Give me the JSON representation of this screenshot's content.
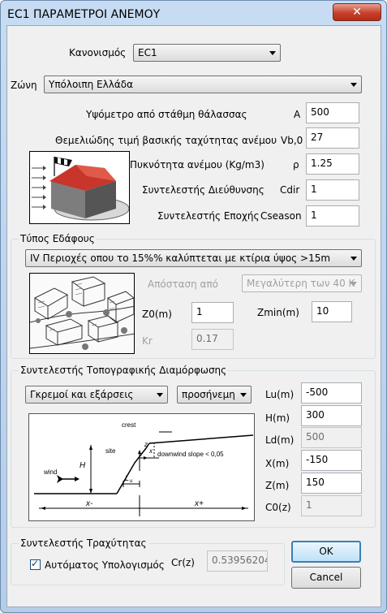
{
  "window": {
    "title": "EC1 ΠΑΡΑΜΕΤΡΟΙ ΑΝΕΜΟΥ",
    "close_glyph": "✕"
  },
  "regulation": {
    "label": "Κανονισμός",
    "value": "EC1"
  },
  "zone": {
    "label": "Ζώνη",
    "value": "Υπόλοιπη Ελλάδα"
  },
  "params": [
    {
      "label": "Υψόμετρο από στάθμη θάλασσας",
      "symbol": "A",
      "value": "500"
    },
    {
      "label": "Θεμελιώδης τιμή βασικής ταχύτητας ανέμου",
      "symbol": "Vb,0",
      "value": "27"
    },
    {
      "label": "Πυκνότητα ανέμου (Kg/m3)",
      "symbol": "ρ",
      "value": "1.25"
    },
    {
      "label": "Συντελεστής Διεύθυνσης",
      "symbol": "Cdir",
      "value": "1"
    },
    {
      "label": "Συντελεστής Εποχής",
      "symbol": "Cseason",
      "value": "1"
    }
  ],
  "terrain": {
    "title": "Τύπος Εδάφους",
    "category": "IV Περιοχές οπου το 15%% καλύπτεται με κτίρια ύψος >15m",
    "distance_label": "Απόσταση από",
    "distance_value": "Μεγαλύτερη των 40 K",
    "z0_label": "Z0(m)",
    "z0_value": "1",
    "zmin_label": "Zmin(m)",
    "zmin_value": "10",
    "kr_label": "Kr",
    "kr_value": "0.17"
  },
  "topography": {
    "title": "Συντελεστής Τοπογραφικής Διαμόρφωσης",
    "type_value": "Γκρεμοί και εξάρσεις",
    "orientation_value": "προσήνεμη",
    "fields": [
      {
        "label": "Lu(m)",
        "value": "-500",
        "readonly": false
      },
      {
        "label": "H(m)",
        "value": "300",
        "readonly": false
      },
      {
        "label": "Ld(m)",
        "value": "500",
        "readonly": true
      },
      {
        "label": "X(m)",
        "value": "-150",
        "readonly": false
      },
      {
        "label": "Z(m)",
        "value": "150",
        "readonly": false
      },
      {
        "label": "C0(z)",
        "value": "1",
        "readonly": true
      }
    ],
    "diagram": {
      "crest": "crest",
      "wind": "wind",
      "site": "site",
      "downwind": "downwind slope < 0,05",
      "h": "H",
      "z": "z",
      "x": "x",
      "lu": "L",
      "lu_sub": "u",
      "x_minus": "x-",
      "x_plus": "x+"
    }
  },
  "roughness": {
    "title": "Συντελεστής Τραχύτητας",
    "auto_label": "Αυτόματος Υπολογισμός",
    "auto_checked": true,
    "check_glyph": "✓",
    "crz_label": "Cr(z)",
    "crz_value": "0.53956204"
  },
  "buttons": {
    "ok": "OK",
    "cancel": "Cancel"
  }
}
